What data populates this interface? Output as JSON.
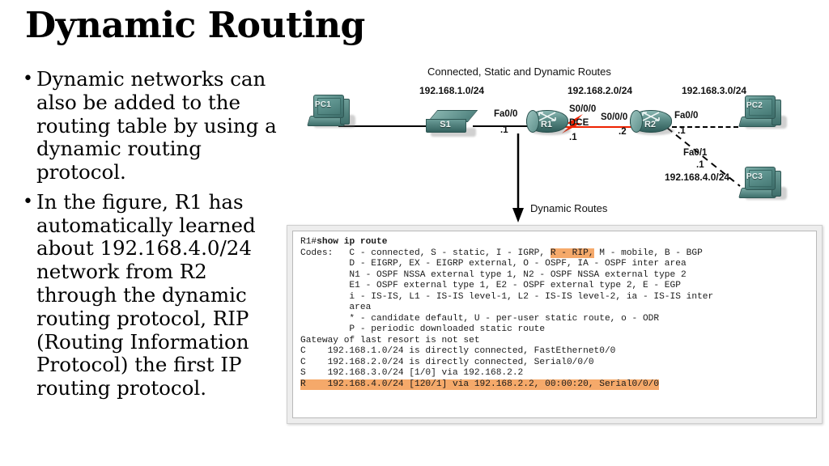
{
  "slide": {
    "title": "Dynamic Routing",
    "bullets": [
      "Dynamic networks can also be added to the routing table by using a dynamic routing protocol.",
      "In the figure, R1 has automatically learned about 192.168.4.0/24 network from R2 through the dynamic routing protocol, RIP (Routing Information Protocol) the first IP routing protocol."
    ],
    "bullet_marker": "•"
  },
  "diagram": {
    "heading": "Connected, Static and Dynamic Routes",
    "annotation": "Dynamic Routes",
    "networks": {
      "net1": "192.168.1.0/24",
      "net2": "192.168.2.0/24",
      "net3": "192.168.3.0/24",
      "net4": "192.168.4.0/24"
    },
    "devices": {
      "pc1": "PC1",
      "pc2": "PC2",
      "pc3": "PC3",
      "s1": "S1",
      "r1": "R1",
      "r2": "R2"
    },
    "interfaces": {
      "r1_fa00": "Fa0/0",
      "r1_fa00_ip": ".1",
      "r1_s000": "S0/0/0",
      "r1_dce": "DCE",
      "r1_s000_ip": ".1",
      "r2_s000": "S0/0/0",
      "r2_s000_ip": ".2",
      "r2_fa00": "Fa0/0",
      "r2_fa00_ip": ".1",
      "r2_fa01": "Fa0/1",
      "r2_fa01_ip": ".1"
    },
    "colors": {
      "device_teal": "#4d817d",
      "serial_link_red": "#ee2200",
      "link_black": "#000000"
    }
  },
  "terminal": {
    "prompt_device": "R1#",
    "command": "show ip route",
    "highlight_color": "#f5a96a",
    "lines": [
      "Codes:   C - connected, S - static, I - IGRP, R - RIP, M - mobile, B - BGP",
      "         D - EIGRP, EX - EIGRP external, O - OSPF, IA - OSPF inter area",
      "         N1 - OSPF NSSA external type 1, N2 - OSPF NSSA external type 2",
      "         E1 - OSPF external type 1, E2 - OSPF external type 2, E - EGP",
      "         i - IS-IS, L1 - IS-IS level-1, L2 - IS-IS level-2, ia - IS-IS inter",
      "         area",
      "         * - candidate default, U - per-user static route, o - ODR",
      "         P - periodic downloaded static route",
      "Gateway of last resort is not set",
      "C    192.168.1.0/24 is directly connected, FastEthernet0/0",
      "C    192.168.2.0/24 is directly connected, Serial0/0/0",
      "S    192.168.3.0/24 [1/0] via 192.168.2.2",
      "R    192.168.4.0/24 [120/1] via 192.168.2.2, 00:00:20, Serial0/0/0"
    ],
    "highlighted_code": "R - RIP,",
    "highlighted_route": "R    192.168.4.0/24 [120/1] via 192.168.2.2, 00:00:20, Serial0/0/0"
  }
}
